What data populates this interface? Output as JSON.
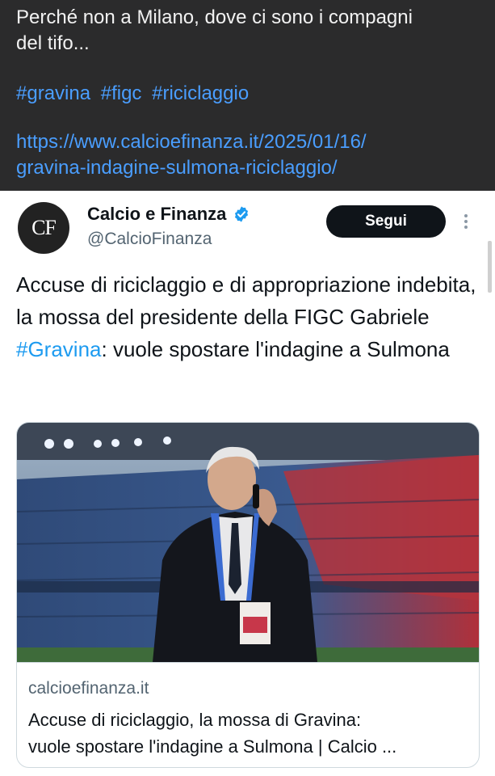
{
  "post": {
    "text_lines": [
      "Perché non a Milano, dove ci sono i compagni",
      "del tifo..."
    ],
    "hashtags": [
      "#gravina",
      "#figc",
      "#riciclaggio"
    ],
    "link_lines": [
      "https://www.calcioefinanza.it/2025/01/16/",
      "gravina-indagine-sulmona-riciclaggio/"
    ]
  },
  "tweet": {
    "avatar_text": "CF",
    "name": "Calcio e Finanza",
    "handle": "@CalcioFinanza",
    "follow_label": "Segui",
    "body_part1": "Accuse di riciclaggio e di appropriazione indebita, la mossa del presidente della FIGC Gabriele ",
    "body_hashtag": "#Gravina",
    "body_part2": ": vuole spostare l'indagine a Sulmona",
    "card": {
      "domain": "calcioefinanza.it",
      "title_lines": [
        "Accuse di riciclaggio, la mossa di Gravina:",
        "vuole spostare l'indagine a Sulmona | Calcio ..."
      ]
    }
  },
  "colors": {
    "dark_bg": "#2b2b2c",
    "link_blue": "#4a9eff",
    "hashtag_blue": "#1d9bf0",
    "follow_bg": "#0f1419",
    "verified_blue": "#1d9bf0"
  }
}
